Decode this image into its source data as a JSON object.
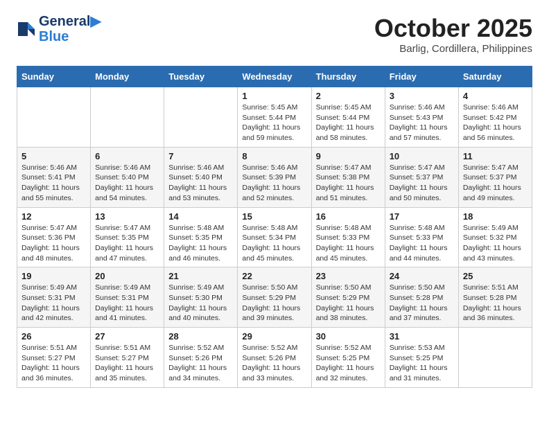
{
  "header": {
    "logo_line1": "General",
    "logo_line2": "Blue",
    "month": "October 2025",
    "location": "Barlig, Cordillera, Philippines"
  },
  "weekdays": [
    "Sunday",
    "Monday",
    "Tuesday",
    "Wednesday",
    "Thursday",
    "Friday",
    "Saturday"
  ],
  "weeks": [
    [
      {
        "day": "",
        "detail": ""
      },
      {
        "day": "",
        "detail": ""
      },
      {
        "day": "",
        "detail": ""
      },
      {
        "day": "1",
        "detail": "Sunrise: 5:45 AM\nSunset: 5:44 PM\nDaylight: 11 hours\nand 59 minutes."
      },
      {
        "day": "2",
        "detail": "Sunrise: 5:45 AM\nSunset: 5:44 PM\nDaylight: 11 hours\nand 58 minutes."
      },
      {
        "day": "3",
        "detail": "Sunrise: 5:46 AM\nSunset: 5:43 PM\nDaylight: 11 hours\nand 57 minutes."
      },
      {
        "day": "4",
        "detail": "Sunrise: 5:46 AM\nSunset: 5:42 PM\nDaylight: 11 hours\nand 56 minutes."
      }
    ],
    [
      {
        "day": "5",
        "detail": "Sunrise: 5:46 AM\nSunset: 5:41 PM\nDaylight: 11 hours\nand 55 minutes."
      },
      {
        "day": "6",
        "detail": "Sunrise: 5:46 AM\nSunset: 5:40 PM\nDaylight: 11 hours\nand 54 minutes."
      },
      {
        "day": "7",
        "detail": "Sunrise: 5:46 AM\nSunset: 5:40 PM\nDaylight: 11 hours\nand 53 minutes."
      },
      {
        "day": "8",
        "detail": "Sunrise: 5:46 AM\nSunset: 5:39 PM\nDaylight: 11 hours\nand 52 minutes."
      },
      {
        "day": "9",
        "detail": "Sunrise: 5:47 AM\nSunset: 5:38 PM\nDaylight: 11 hours\nand 51 minutes."
      },
      {
        "day": "10",
        "detail": "Sunrise: 5:47 AM\nSunset: 5:37 PM\nDaylight: 11 hours\nand 50 minutes."
      },
      {
        "day": "11",
        "detail": "Sunrise: 5:47 AM\nSunset: 5:37 PM\nDaylight: 11 hours\nand 49 minutes."
      }
    ],
    [
      {
        "day": "12",
        "detail": "Sunrise: 5:47 AM\nSunset: 5:36 PM\nDaylight: 11 hours\nand 48 minutes."
      },
      {
        "day": "13",
        "detail": "Sunrise: 5:47 AM\nSunset: 5:35 PM\nDaylight: 11 hours\nand 47 minutes."
      },
      {
        "day": "14",
        "detail": "Sunrise: 5:48 AM\nSunset: 5:35 PM\nDaylight: 11 hours\nand 46 minutes."
      },
      {
        "day": "15",
        "detail": "Sunrise: 5:48 AM\nSunset: 5:34 PM\nDaylight: 11 hours\nand 45 minutes."
      },
      {
        "day": "16",
        "detail": "Sunrise: 5:48 AM\nSunset: 5:33 PM\nDaylight: 11 hours\nand 45 minutes."
      },
      {
        "day": "17",
        "detail": "Sunrise: 5:48 AM\nSunset: 5:33 PM\nDaylight: 11 hours\nand 44 minutes."
      },
      {
        "day": "18",
        "detail": "Sunrise: 5:49 AM\nSunset: 5:32 PM\nDaylight: 11 hours\nand 43 minutes."
      }
    ],
    [
      {
        "day": "19",
        "detail": "Sunrise: 5:49 AM\nSunset: 5:31 PM\nDaylight: 11 hours\nand 42 minutes."
      },
      {
        "day": "20",
        "detail": "Sunrise: 5:49 AM\nSunset: 5:31 PM\nDaylight: 11 hours\nand 41 minutes."
      },
      {
        "day": "21",
        "detail": "Sunrise: 5:49 AM\nSunset: 5:30 PM\nDaylight: 11 hours\nand 40 minutes."
      },
      {
        "day": "22",
        "detail": "Sunrise: 5:50 AM\nSunset: 5:29 PM\nDaylight: 11 hours\nand 39 minutes."
      },
      {
        "day": "23",
        "detail": "Sunrise: 5:50 AM\nSunset: 5:29 PM\nDaylight: 11 hours\nand 38 minutes."
      },
      {
        "day": "24",
        "detail": "Sunrise: 5:50 AM\nSunset: 5:28 PM\nDaylight: 11 hours\nand 37 minutes."
      },
      {
        "day": "25",
        "detail": "Sunrise: 5:51 AM\nSunset: 5:28 PM\nDaylight: 11 hours\nand 36 minutes."
      }
    ],
    [
      {
        "day": "26",
        "detail": "Sunrise: 5:51 AM\nSunset: 5:27 PM\nDaylight: 11 hours\nand 36 minutes."
      },
      {
        "day": "27",
        "detail": "Sunrise: 5:51 AM\nSunset: 5:27 PM\nDaylight: 11 hours\nand 35 minutes."
      },
      {
        "day": "28",
        "detail": "Sunrise: 5:52 AM\nSunset: 5:26 PM\nDaylight: 11 hours\nand 34 minutes."
      },
      {
        "day": "29",
        "detail": "Sunrise: 5:52 AM\nSunset: 5:26 PM\nDaylight: 11 hours\nand 33 minutes."
      },
      {
        "day": "30",
        "detail": "Sunrise: 5:52 AM\nSunset: 5:25 PM\nDaylight: 11 hours\nand 32 minutes."
      },
      {
        "day": "31",
        "detail": "Sunrise: 5:53 AM\nSunset: 5:25 PM\nDaylight: 11 hours\nand 31 minutes."
      },
      {
        "day": "",
        "detail": ""
      }
    ]
  ]
}
